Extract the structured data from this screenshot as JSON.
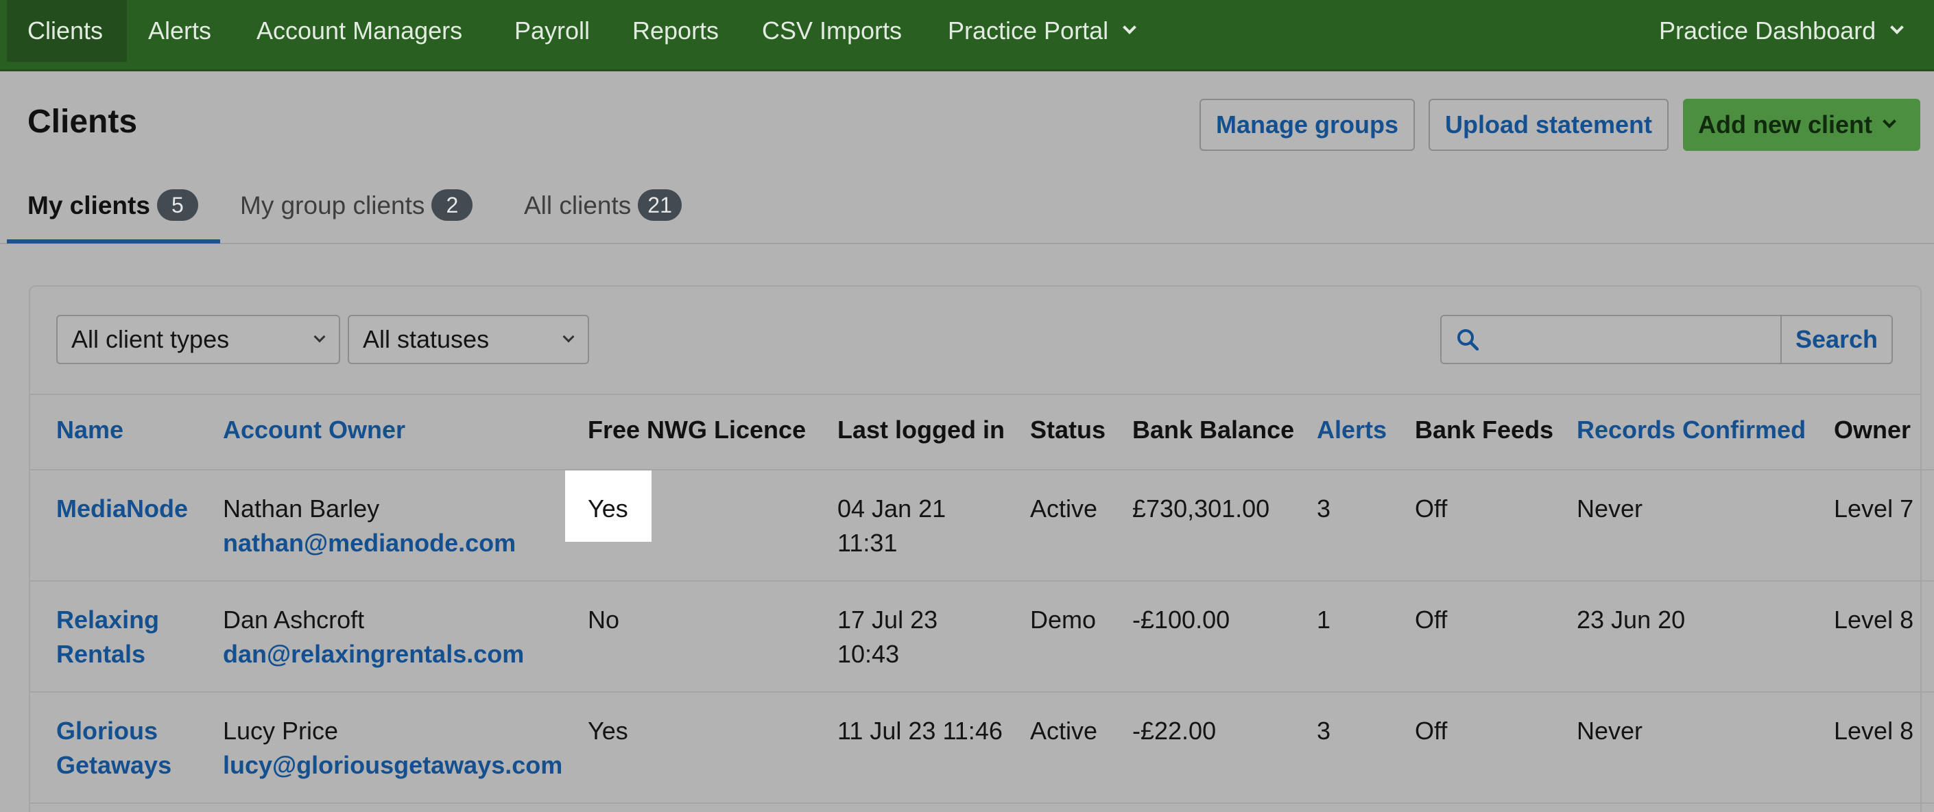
{
  "nav": {
    "items": [
      "Clients",
      "Alerts",
      "Account Managers",
      "Payroll",
      "Reports",
      "CSV Imports",
      "Practice Portal"
    ],
    "right_label": "Practice Dashboard"
  },
  "header": {
    "title": "Clients",
    "manage_groups": "Manage groups",
    "upload_statement": "Upload statement",
    "add_new_client": "Add new client"
  },
  "tabs": [
    {
      "label": "My clients",
      "count": "5"
    },
    {
      "label": "My group clients",
      "count": "2"
    },
    {
      "label": "All clients",
      "count": "21"
    }
  ],
  "filters": {
    "client_type": "All client types",
    "status": "All statuses",
    "search_placeholder": "",
    "search_button": "Search"
  },
  "table": {
    "headers": [
      "Name",
      "Account Owner",
      "Free NWG Licence",
      "Last logged in",
      "Status",
      "Bank Balance",
      "Alerts",
      "Bank Feeds",
      "Records Confirmed",
      "Owner"
    ],
    "rows": [
      {
        "name": [
          "MediaNode"
        ],
        "owner_name": "Nathan Barley",
        "owner_email": "nathan@medianode.com",
        "licence": "Yes",
        "last_login": [
          "04 Jan 21",
          "11:31"
        ],
        "status": "Active",
        "balance": "£730,301.00",
        "alerts": "3",
        "feeds": "Off",
        "confirmed": "Never",
        "owner": "Level 7"
      },
      {
        "name": [
          "Relaxing",
          "Rentals"
        ],
        "owner_name": "Dan Ashcroft",
        "owner_email": "dan@relaxingrentals.com",
        "licence": "No",
        "last_login": [
          "17 Jul 23",
          "10:43"
        ],
        "status": "Demo",
        "balance": "-£100.00",
        "alerts": "1",
        "feeds": "Off",
        "confirmed": "23 Jun 20",
        "owner": "Level 8"
      },
      {
        "name": [
          "Glorious",
          "Getaways"
        ],
        "owner_name": "Lucy Price",
        "owner_email": "lucy@gloriousgetaways.com",
        "licence": "Yes",
        "last_login": [
          "11 Jul 23 11:46"
        ],
        "status": "Active",
        "balance": "-£22.00",
        "alerts": "3",
        "feeds": "Off",
        "confirmed": "Never",
        "owner": "Level 8"
      }
    ]
  },
  "colors": {
    "nav_bg": "#2a5f22",
    "accent_link": "#14508f",
    "primary_button": "#4d8f41",
    "badge": "#434b52"
  }
}
